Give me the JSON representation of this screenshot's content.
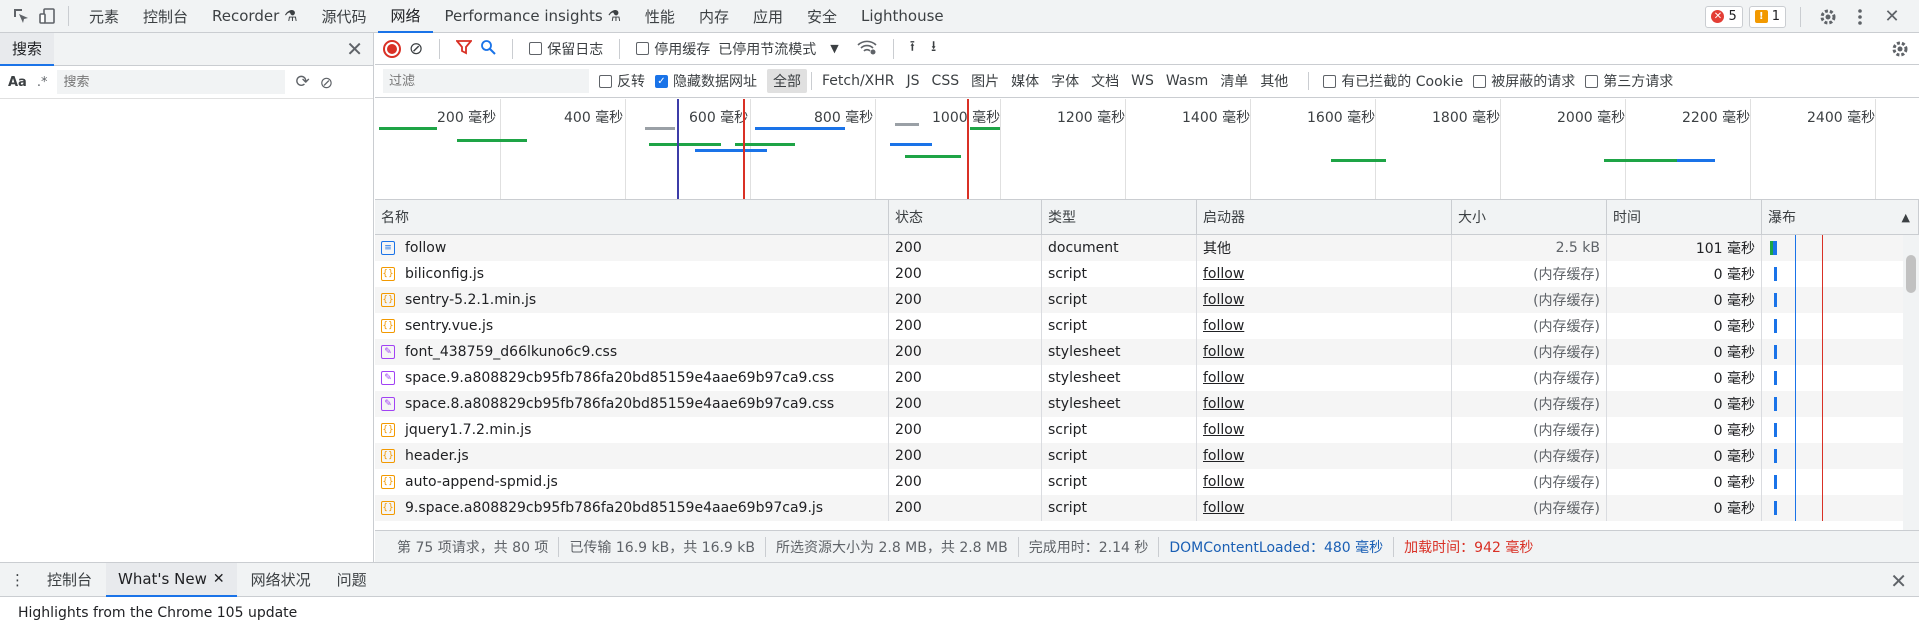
{
  "top_tabs": [
    "元素",
    "控制台",
    "Recorder ⚗",
    "源代码",
    "网络",
    "Performance insights ⚗",
    "性能",
    "内存",
    "应用",
    "安全",
    "Lighthouse"
  ],
  "active_tab": "网络",
  "badges": {
    "errors": "5",
    "warnings": "1"
  },
  "left_panel": {
    "tab": "搜索",
    "aa": "Aa",
    "regex": ".*",
    "search_placeholder": "搜索"
  },
  "toolbar": {
    "preserve_log": "保留日志",
    "disable_cache": "停用缓存",
    "throttle": "已停用节流模式"
  },
  "filter": {
    "placeholder": "过滤",
    "invert": "反转",
    "hide_data_urls": "隐藏数据网址",
    "types": [
      "全部",
      "Fetch/XHR",
      "JS",
      "CSS",
      "图片",
      "媒体",
      "字体",
      "文档",
      "WS",
      "Wasm",
      "清单",
      "其他"
    ],
    "blocked_cookies": "有已拦截的 Cookie",
    "blocked_requests": "被屏蔽的请求",
    "third_party": "第三方请求"
  },
  "overview_labels": [
    "200 毫秒",
    "400 毫秒",
    "600 毫秒",
    "800 毫秒",
    "1000 毫秒",
    "1200 毫秒",
    "1400 毫秒",
    "1600 毫秒",
    "1800 毫秒",
    "2000 毫秒",
    "2200 毫秒",
    "2400 毫秒"
  ],
  "columns": {
    "name": "名称",
    "status": "状态",
    "type": "类型",
    "initiator": "启动器",
    "size": "大小",
    "time": "时间",
    "waterfall": "瀑布"
  },
  "rows": [
    {
      "name": "follow",
      "status": "200",
      "type": "document",
      "initiator": "其他",
      "size": "2.5 kB",
      "time": "101 毫秒",
      "kind": "doc",
      "link": false
    },
    {
      "name": "biliconfig.js",
      "status": "200",
      "type": "script",
      "initiator": "follow",
      "size": "(内存缓存)",
      "time": "0 毫秒",
      "kind": "script",
      "link": true
    },
    {
      "name": "sentry-5.2.1.min.js",
      "status": "200",
      "type": "script",
      "initiator": "follow",
      "size": "(内存缓存)",
      "time": "0 毫秒",
      "kind": "script",
      "link": true
    },
    {
      "name": "sentry.vue.js",
      "status": "200",
      "type": "script",
      "initiator": "follow",
      "size": "(内存缓存)",
      "time": "0 毫秒",
      "kind": "script",
      "link": true
    },
    {
      "name": "font_438759_d66lkuno6c9.css",
      "status": "200",
      "type": "stylesheet",
      "initiator": "follow",
      "size": "(内存缓存)",
      "time": "0 毫秒",
      "kind": "css",
      "link": true
    },
    {
      "name": "space.9.a808829cb95fb786fa20bd85159e4aae69b97ca9.css",
      "status": "200",
      "type": "stylesheet",
      "initiator": "follow",
      "size": "(内存缓存)",
      "time": "0 毫秒",
      "kind": "css",
      "link": true
    },
    {
      "name": "space.8.a808829cb95fb786fa20bd85159e4aae69b97ca9.css",
      "status": "200",
      "type": "stylesheet",
      "initiator": "follow",
      "size": "(内存缓存)",
      "time": "0 毫秒",
      "kind": "css",
      "link": true
    },
    {
      "name": "jquery1.7.2.min.js",
      "status": "200",
      "type": "script",
      "initiator": "follow",
      "size": "(内存缓存)",
      "time": "0 毫秒",
      "kind": "script",
      "link": true
    },
    {
      "name": "header.js",
      "status": "200",
      "type": "script",
      "initiator": "follow",
      "size": "(内存缓存)",
      "time": "0 毫秒",
      "kind": "script",
      "link": true
    },
    {
      "name": "auto-append-spmid.js",
      "status": "200",
      "type": "script",
      "initiator": "follow",
      "size": "(内存缓存)",
      "time": "0 毫秒",
      "kind": "script",
      "link": true
    },
    {
      "name": "9.space.a808829cb95fb786fa20bd85159e4aae69b97ca9.js",
      "status": "200",
      "type": "script",
      "initiator": "follow",
      "size": "(内存缓存)",
      "time": "0 毫秒",
      "kind": "script",
      "link": true
    }
  ],
  "status_bar": {
    "requests": "第 75 项请求，共 80 项",
    "transferred": "已传输 16.9 kB，共 16.9 kB",
    "resources": "所选资源大小为 2.8 MB，共 2.8 MB",
    "finish": "完成用时：2.14 秒",
    "dcl": "DOMContentLoaded：480 毫秒",
    "load": "加载时间：942 毫秒"
  },
  "drawer": {
    "tabs": [
      "控制台",
      "What's New",
      "网络状况",
      "问题"
    ],
    "active": "What's New",
    "body": "Highlights from the Chrome 105 update"
  },
  "colors": {
    "accent": "#1a73e8",
    "error": "#d93025",
    "dcl_line": "#3c3ca8",
    "load_line": "#d93025"
  }
}
